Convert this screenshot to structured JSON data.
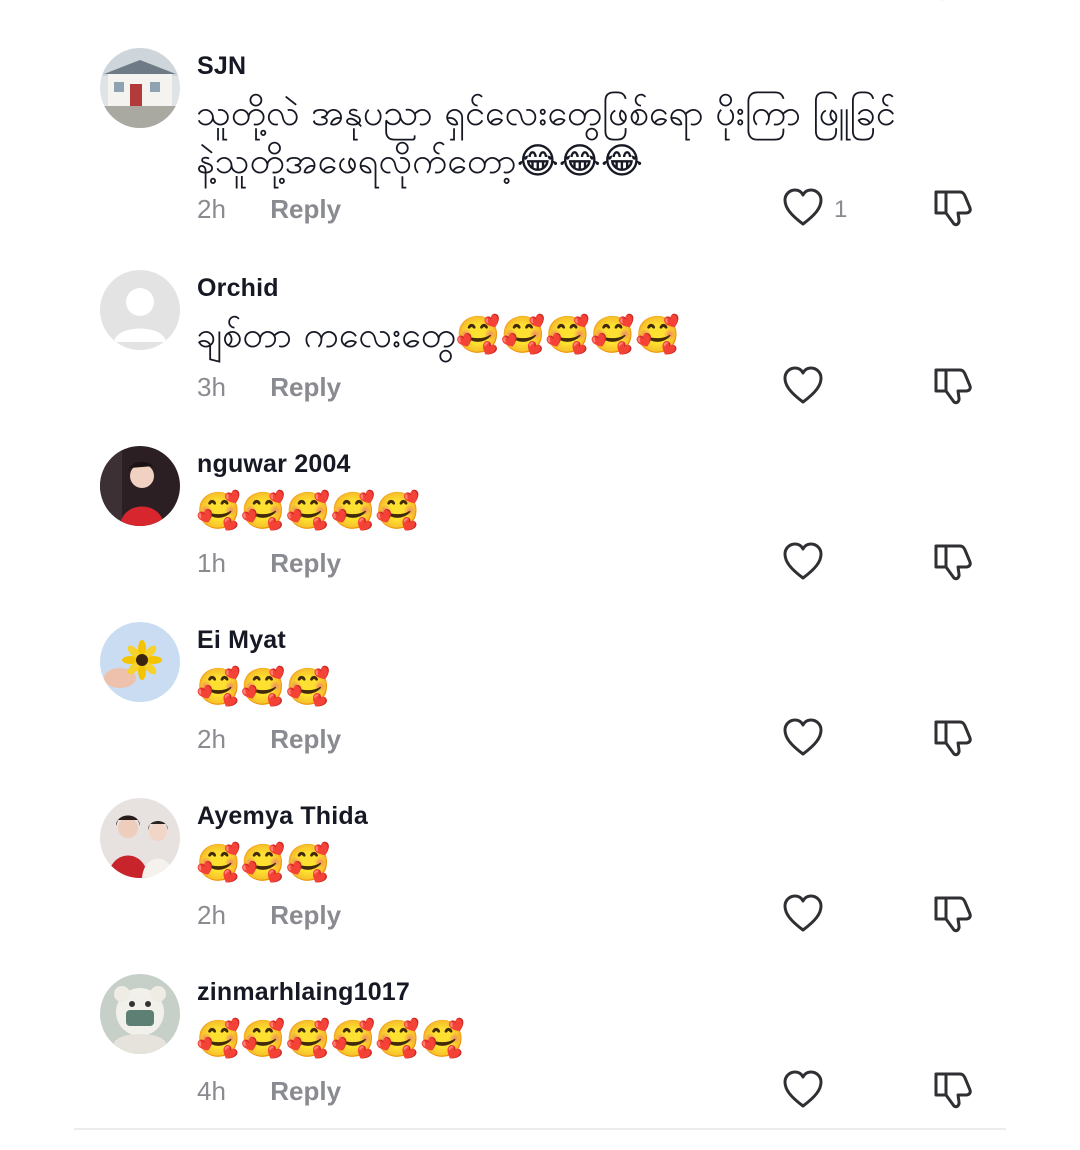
{
  "comments": [
    {
      "username": "SJN",
      "text": "သူတို့လဲ အနုပညာ ရှင်လေးတွေဖြစ်ရော ပိုးကြာ ဖြူခြင်နဲ့သူတို့အဖေရလိုက်တော့😂😂😂",
      "time": "2h",
      "reply": "Reply",
      "like_count": "1",
      "avatar": "house-photo"
    },
    {
      "username": "Orchid",
      "text": "ချစ်တာ ကလေးတွေ🥰🥰🥰🥰🥰",
      "time": "3h",
      "reply": "Reply",
      "like_count": "",
      "avatar": "default-person"
    },
    {
      "username": "nguwar 2004",
      "text": "🥰🥰🥰🥰🥰",
      "time": "1h",
      "reply": "Reply",
      "like_count": "",
      "avatar": "woman-red-dress-photo"
    },
    {
      "username": "Ei Myat",
      "text": "🥰🥰🥰",
      "time": "2h",
      "reply": "Reply",
      "like_count": "",
      "avatar": "yellow-flower-photo"
    },
    {
      "username": "Ayemya Thida",
      "text": "🥰🥰🥰",
      "time": "2h",
      "reply": "Reply",
      "like_count": "",
      "avatar": "two-women-photo"
    },
    {
      "username": "zinmarhlaing1017",
      "text": "🥰🥰🥰🥰🥰🥰",
      "time": "4h",
      "reply": "Reply",
      "like_count": "",
      "avatar": "plush-toy-photo"
    }
  ],
  "icons": {
    "like": "heart-outline-icon",
    "dislike": "thumbs-down-outline-icon"
  },
  "colors": {
    "text_primary": "#161823",
    "text_secondary": "#8a8b91",
    "icon": "#2f2f34"
  }
}
